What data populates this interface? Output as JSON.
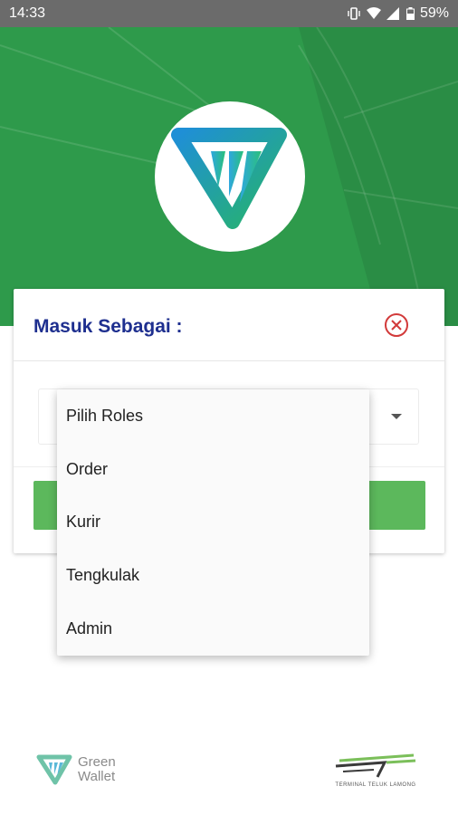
{
  "status_bar": {
    "time": "14:33",
    "battery": "59%",
    "icons": [
      "vibrate-icon",
      "wifi-icon",
      "signal-icon",
      "battery-icon"
    ]
  },
  "dialog": {
    "title": "Masuk Sebagai :"
  },
  "dropdown": {
    "items": [
      "Pilih Roles",
      "Order",
      "Kurir",
      "Tengkulak",
      "Admin"
    ]
  },
  "footer": {
    "left_logo_line1": "Green",
    "left_logo_line2": "Wallet",
    "right_logo_text": "TERMINAL TELUK LAMONG"
  },
  "colors": {
    "hero_green": "#2e9a4b",
    "title_blue": "#1e2f8f",
    "close_red": "#d23a3a",
    "button_green": "#5cb85c",
    "status_bar": "#6b6b6b"
  }
}
